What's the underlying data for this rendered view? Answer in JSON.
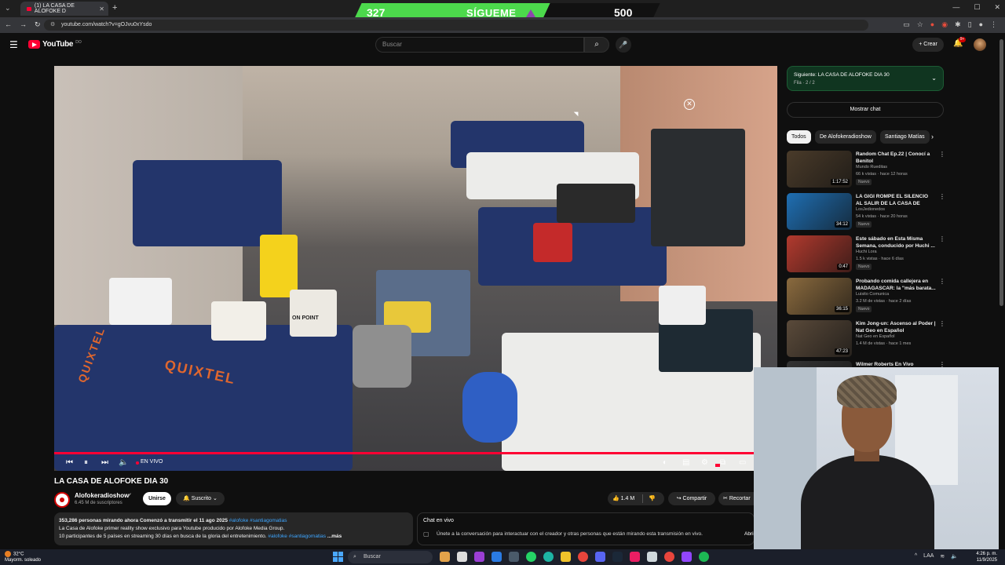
{
  "browser": {
    "tab_title": "(1) LA CASA DE ALOFOKE D",
    "url": "youtube.com/watch?v=gOJvu0xYsdo",
    "new_tab": "+",
    "close_tab": "✕"
  },
  "overlay": {
    "count_left": "327",
    "label": "SÍGUEME",
    "count_right": "500"
  },
  "header": {
    "logo_text": "YouTube",
    "logo_country": "DO",
    "search_placeholder": "Buscar",
    "create_label": "Crear",
    "notification_count": "9+"
  },
  "player": {
    "live_label": "EN VIVO",
    "accent": "#ff0033"
  },
  "video": {
    "title": "LA CASA DE ALOFOKE DIA 30",
    "channel": "Alofokeradioshow",
    "subscribers": "6.45 M de suscriptores",
    "join_label": "Unirse",
    "subscribed_label": "Suscrito",
    "likes": "1.4 M",
    "share_label": "Compartir",
    "clip_label": "Recortar",
    "bed_text_1": "QUIXTEL",
    "bed_text_2": "ON POINT"
  },
  "description": {
    "stats": "353,286 personas mirando ahora  Comenzó a transmitir el 11 ago 2025",
    "tags_1": "#alofoke #santiagomatias",
    "line_2": "La Casa de Alofoke primer reality show exclusivo para Youtube producido por Alofoke Media Group.",
    "line_3": "10 participantes de 5 países en streaming 30 días en busca de la gloria del entretenimiento.",
    "tags_2": "#alofoke #santiagomatias",
    "more": "...más"
  },
  "chat": {
    "title": "Chat en vivo",
    "prompt": "Únete a la conversación para interactuar con el creador y otras personas que están mirando esta transmisión en vivo.",
    "button": "Abrir"
  },
  "sidebar": {
    "next_title": "Siguiente: LA CASA DE ALOFOKE DIA 30",
    "next_sub": "Fila · 2 / 2",
    "show_chat": "Mostrar chat",
    "chips": [
      "Todos",
      "De Alofokeradioshow",
      "Santiago Matías"
    ],
    "recommendations": [
      {
        "title": "Random Chat Ep.22 | Conocí a Benitol",
        "channel": "Mundo Rueditas",
        "meta": "66 k vistas · hace 12 horas",
        "badge": "Nuevo",
        "duration": "1:17:52",
        "thumb": "#4a3b2a"
      },
      {
        "title": "LA GIGI ROMPE EL SILENCIO AL SALIR DE LA CASA DE ALOFOKE",
        "channel": "LosJedionedos",
        "meta": "54 k vistas · hace 20 horas",
        "badge": "Nuevo",
        "duration": "34:12",
        "thumb": "#1f6fb3"
      },
      {
        "title": "Este sábado en Esta Misma Semana, conducido por Huchi ...",
        "channel": "Huchi Lora",
        "meta": "1.5 k vistas · hace 6 días",
        "badge": "Nuevo",
        "duration": "0:47",
        "thumb": "#b23a2e"
      },
      {
        "title": "Probando comida callejera en MADAGASCAR: la \"más barata...",
        "channel": "Luisito Comunica",
        "meta": "3.2 M de vistas · hace 2 días",
        "badge": "Nuevo",
        "duration": "36:15",
        "thumb": "#8a6a3e"
      },
      {
        "title": "Kim Jong-un: Ascenso al Poder | Nat Geo en Español",
        "channel": "Nat Geo en Español",
        "meta": "1.4 M de vistas · hace 1 mes",
        "badge": "",
        "duration": "47:23",
        "thumb": "#5a4a3a"
      },
      {
        "title": "Wilmer Roberts En Vivo",
        "channel": "",
        "meta": "",
        "badge": "",
        "duration": "",
        "thumb": "#333333"
      }
    ]
  },
  "taskbar": {
    "temperature": "32°C",
    "weather": "Mayorm. soleado",
    "search": "Buscar",
    "language": "LAA",
    "time": "4:26 p. m.",
    "date": "11/9/2025"
  }
}
